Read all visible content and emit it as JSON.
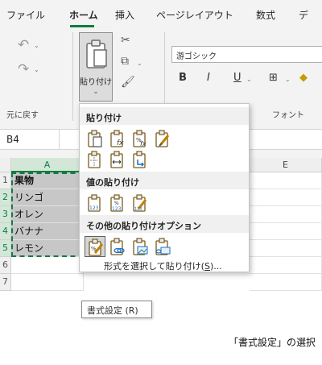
{
  "menu": {
    "tabs": [
      {
        "label": "ファイル"
      },
      {
        "label": "ホーム",
        "active": true
      },
      {
        "label": "挿入"
      },
      {
        "label": "ページレイアウト"
      },
      {
        "label": "数式"
      },
      {
        "label": "デ"
      }
    ]
  },
  "ribbon": {
    "undo_group_label": "元に戻す",
    "paste_label": "貼り付け",
    "font_group_label": "フォント",
    "font_name": "游ゴシック",
    "bold_label": "B",
    "italic_label": "I",
    "underline_label": "U"
  },
  "name_box": "B4",
  "grid": {
    "columns": [
      "A",
      "E"
    ],
    "rows": [
      "1",
      "2",
      "3",
      "4",
      "5",
      "6",
      "7"
    ],
    "cells_a": [
      "果物",
      "リンゴ",
      "オレン",
      "バナナ",
      "レモン",
      "",
      ""
    ]
  },
  "paste_menu": {
    "header_paste": "貼り付け",
    "header_values": "値の貼り付け",
    "header_other": "その他の貼り付けオプション",
    "paste_special_prefix": "形式を選択して貼り付け(",
    "paste_special_key": "S",
    "paste_special_suffix": ")..."
  },
  "tooltip": "書式設定 (R)",
  "caption": "「書式設定」の選択",
  "colors": {
    "accent": "#107c41",
    "selection": "#d3e7d9"
  }
}
